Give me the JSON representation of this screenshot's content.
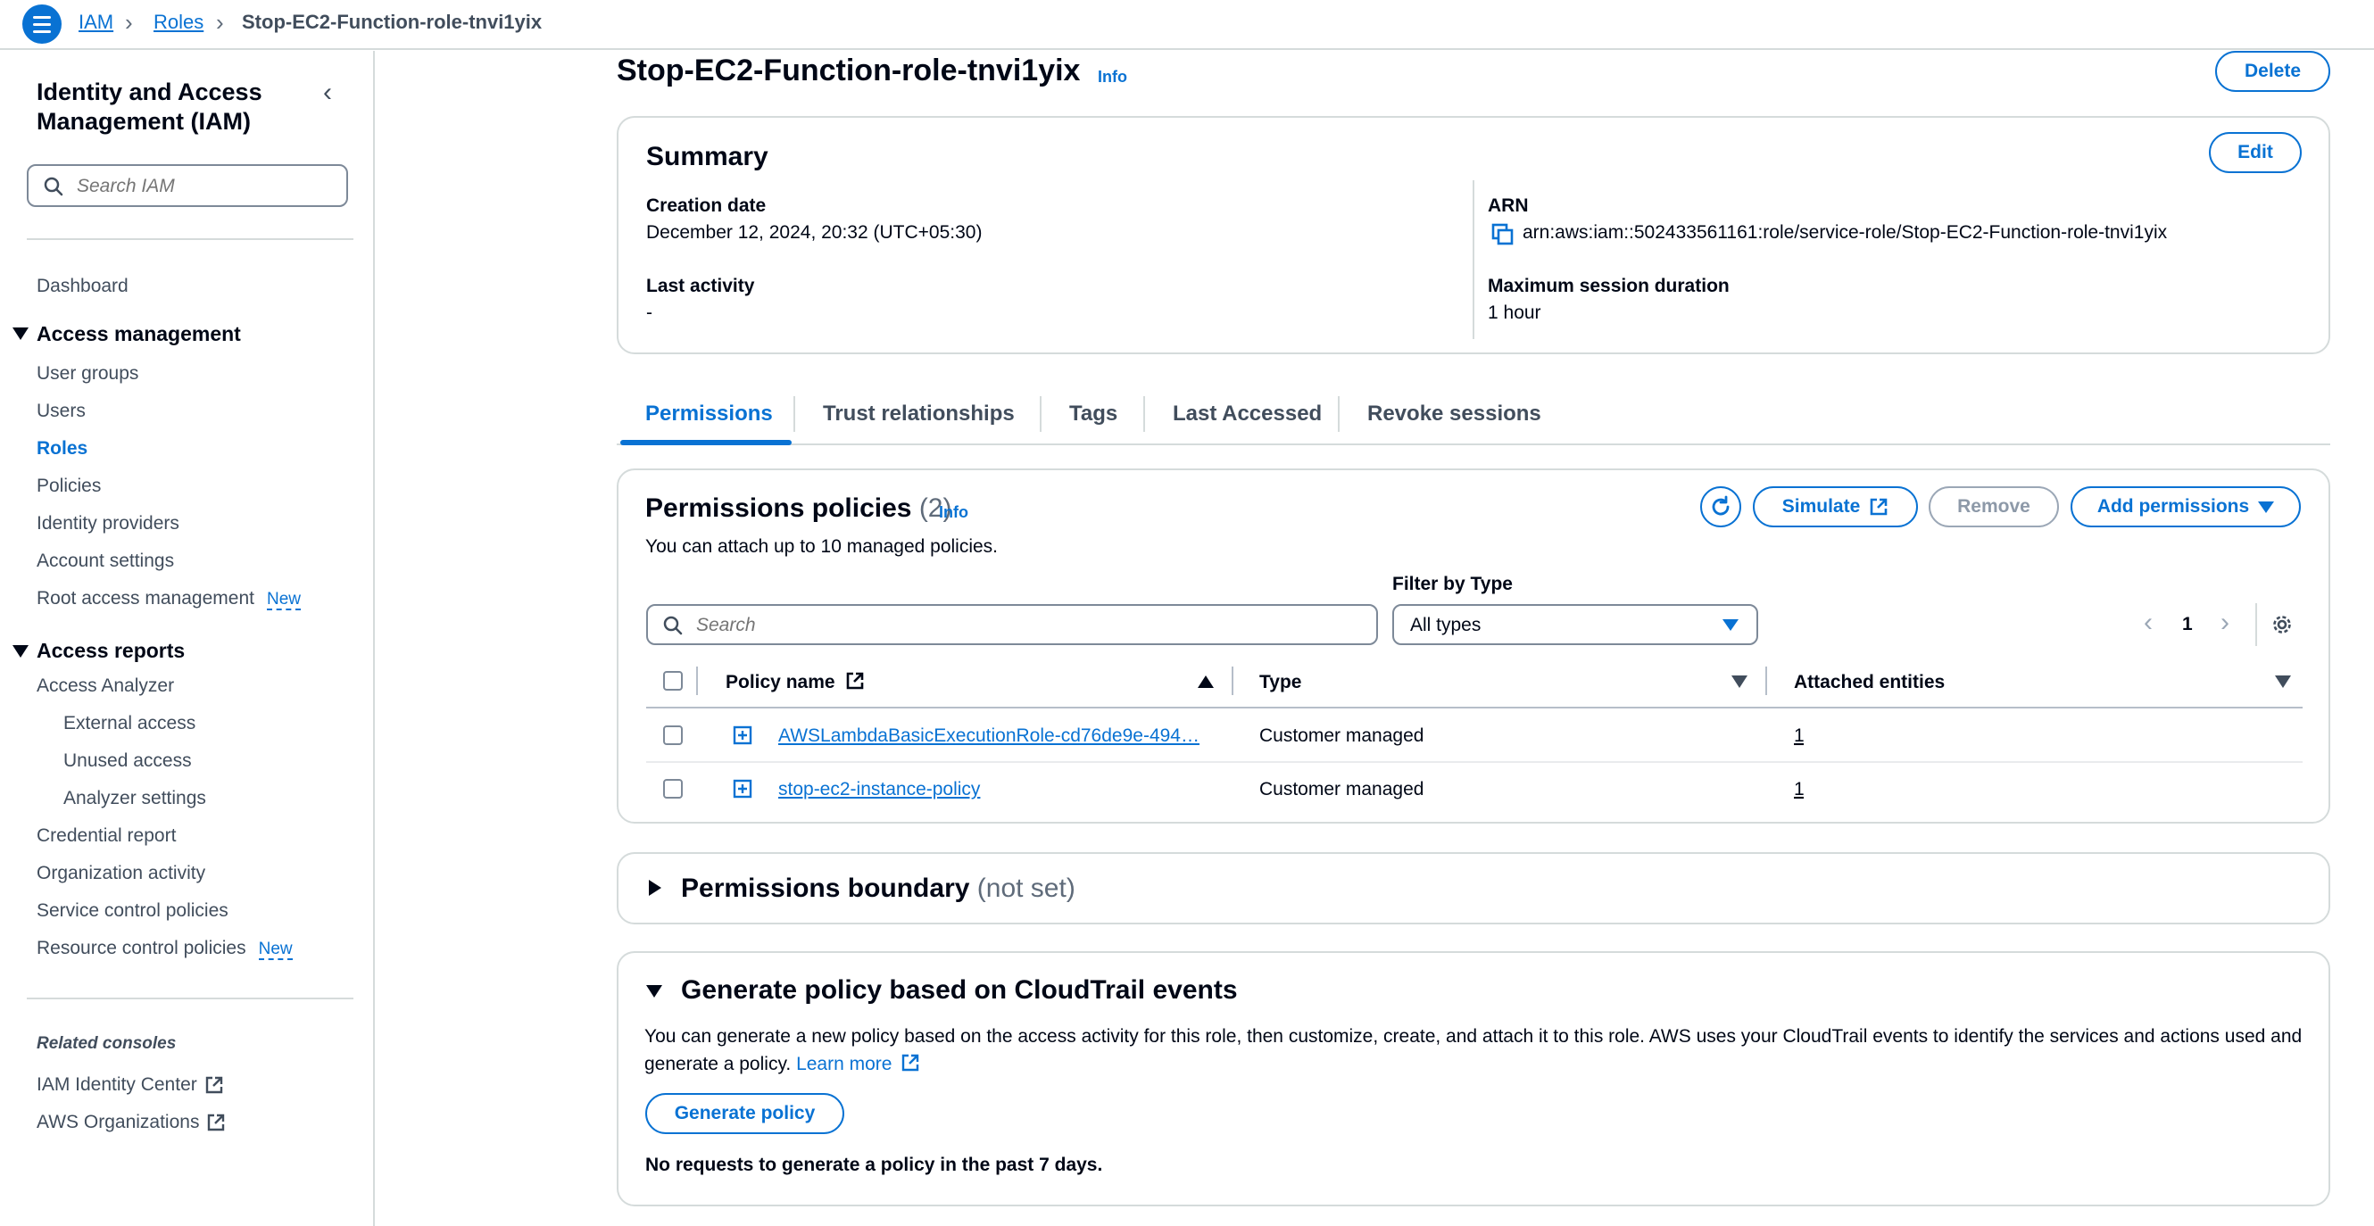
{
  "breadcrumb": {
    "items": [
      "IAM",
      "Roles"
    ],
    "current": "Stop-EC2-Function-role-tnvi1yix"
  },
  "sidebar": {
    "title": "Identity and Access Management (IAM)",
    "search_placeholder": "Search IAM",
    "dashboard": "Dashboard",
    "access_management": {
      "heading": "Access management",
      "items": [
        "User groups",
        "Users",
        "Roles",
        "Policies",
        "Identity providers",
        "Account settings",
        "Root access management"
      ],
      "active": "Roles",
      "new_badge": "New"
    },
    "access_reports": {
      "heading": "Access reports",
      "analyzer": "Access Analyzer",
      "analyzer_children": [
        "External access",
        "Unused access",
        "Analyzer settings"
      ],
      "items": [
        "Credential report",
        "Organization activity",
        "Service control policies",
        "Resource control policies"
      ],
      "new_badge": "New"
    },
    "related_consoles": {
      "heading": "Related consoles",
      "items": [
        "IAM Identity Center",
        "AWS Organizations"
      ]
    }
  },
  "page": {
    "title": "Stop-EC2-Function-role-tnvi1yix",
    "info": "Info",
    "delete_label": "Delete"
  },
  "summary": {
    "title": "Summary",
    "edit_label": "Edit",
    "creation_date_label": "Creation date",
    "creation_date": "December 12, 2024, 20:32 (UTC+05:30)",
    "last_activity_label": "Last activity",
    "last_activity": "-",
    "arn_label": "ARN",
    "arn": "arn:aws:iam::502433561161:role/service-role/Stop-EC2-Function-role-tnvi1yix",
    "max_session_label": "Maximum session duration",
    "max_session": "1 hour"
  },
  "tabs": [
    "Permissions",
    "Trust relationships",
    "Tags",
    "Last Accessed",
    "Revoke sessions"
  ],
  "active_tab": "Permissions",
  "permissions": {
    "title": "Permissions policies",
    "count": "(2)",
    "info": "Info",
    "description": "You can attach up to 10 managed policies.",
    "simulate_label": "Simulate",
    "remove_label": "Remove",
    "add_label": "Add permissions",
    "filter_label": "Filter by Type",
    "search_placeholder": "Search",
    "filter_value": "All types",
    "page_number": "1",
    "columns": [
      "Policy name",
      "Type",
      "Attached entities"
    ],
    "rows": [
      {
        "name": "AWSLambdaBasicExecutionRole-cd76de9e-494…",
        "type": "Customer managed",
        "entities": "1"
      },
      {
        "name": "stop-ec2-instance-policy",
        "type": "Customer managed",
        "entities": "1"
      }
    ]
  },
  "boundary": {
    "title": "Permissions boundary",
    "status": "(not set)"
  },
  "generate": {
    "title": "Generate policy based on CloudTrail events",
    "description": "You can generate a new policy based on the access activity for this role, then customize, create, and attach it to this role. AWS uses your CloudTrail events to identify the services and actions used and generate a policy.",
    "learn_more": "Learn more",
    "button_label": "Generate policy",
    "no_requests": "No requests to generate a policy in the past 7 days."
  },
  "colors": {
    "accent": "#0972d3",
    "text": "#000716",
    "border": "#d5dbdb"
  }
}
